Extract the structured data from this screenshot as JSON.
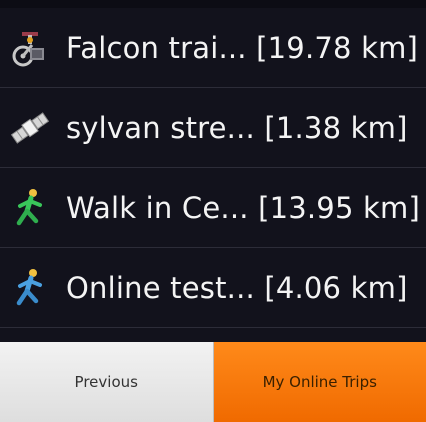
{
  "trips": [
    {
      "label": "Falcon trai... [19.78 km]",
      "icon": "cycling-icon"
    },
    {
      "label": "sylvan stre... [1.38 km]",
      "icon": "satellite-icon"
    },
    {
      "label": "Walk in Ce... [13.95 km]",
      "icon": "walking-icon"
    },
    {
      "label": "Online test... [4.06 km]",
      "icon": "walking-icon"
    }
  ],
  "bottom_bar": {
    "previous_label": "Previous",
    "online_trips_label": "My Online Trips"
  },
  "colors": {
    "background": "#12121c",
    "accent": "#f47a0c",
    "button_light": "#e8e8e8"
  }
}
